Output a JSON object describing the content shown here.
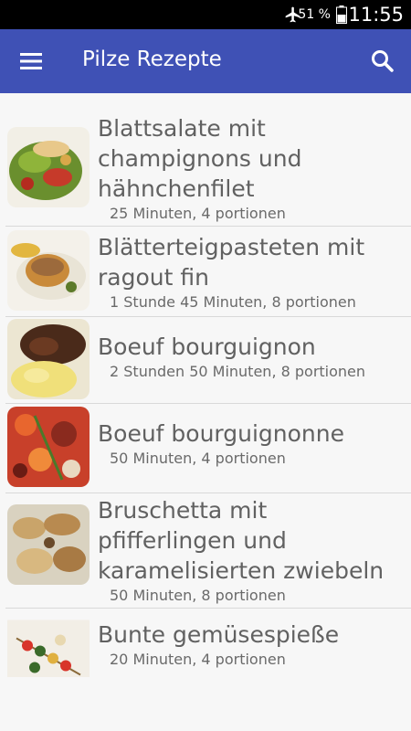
{
  "status_bar": {
    "battery_percent": "51 %",
    "time": "11:55",
    "icons": [
      "airplane-mode-icon",
      "battery-icon"
    ]
  },
  "app_bar": {
    "title": "Pilze Rezepte",
    "icons": [
      "menu-icon",
      "search-icon"
    ],
    "color": "#3f51b5"
  },
  "recipes": [
    {
      "name": "Blattsalate mit champignons und hähnchenfilet",
      "meta": "25 Minuten, 4 portionen"
    },
    {
      "name": "Blätterteigpasteten mit ragout fin",
      "meta": "1 Stunde 45 Minuten, 8 portionen"
    },
    {
      "name": "Boeuf bourguignon",
      "meta": "2 Stunden 50 Minuten, 8 portionen"
    },
    {
      "name": "Boeuf bourguignonne",
      "meta": "50 Minuten, 4 portionen"
    },
    {
      "name": "Bruschetta mit pfifferlingen und karamelisierten zwiebeln",
      "meta": "50 Minuten, 8 portionen"
    },
    {
      "name": "Bunte gemüsespieße",
      "meta": "20 Minuten, 4 portionen"
    }
  ]
}
